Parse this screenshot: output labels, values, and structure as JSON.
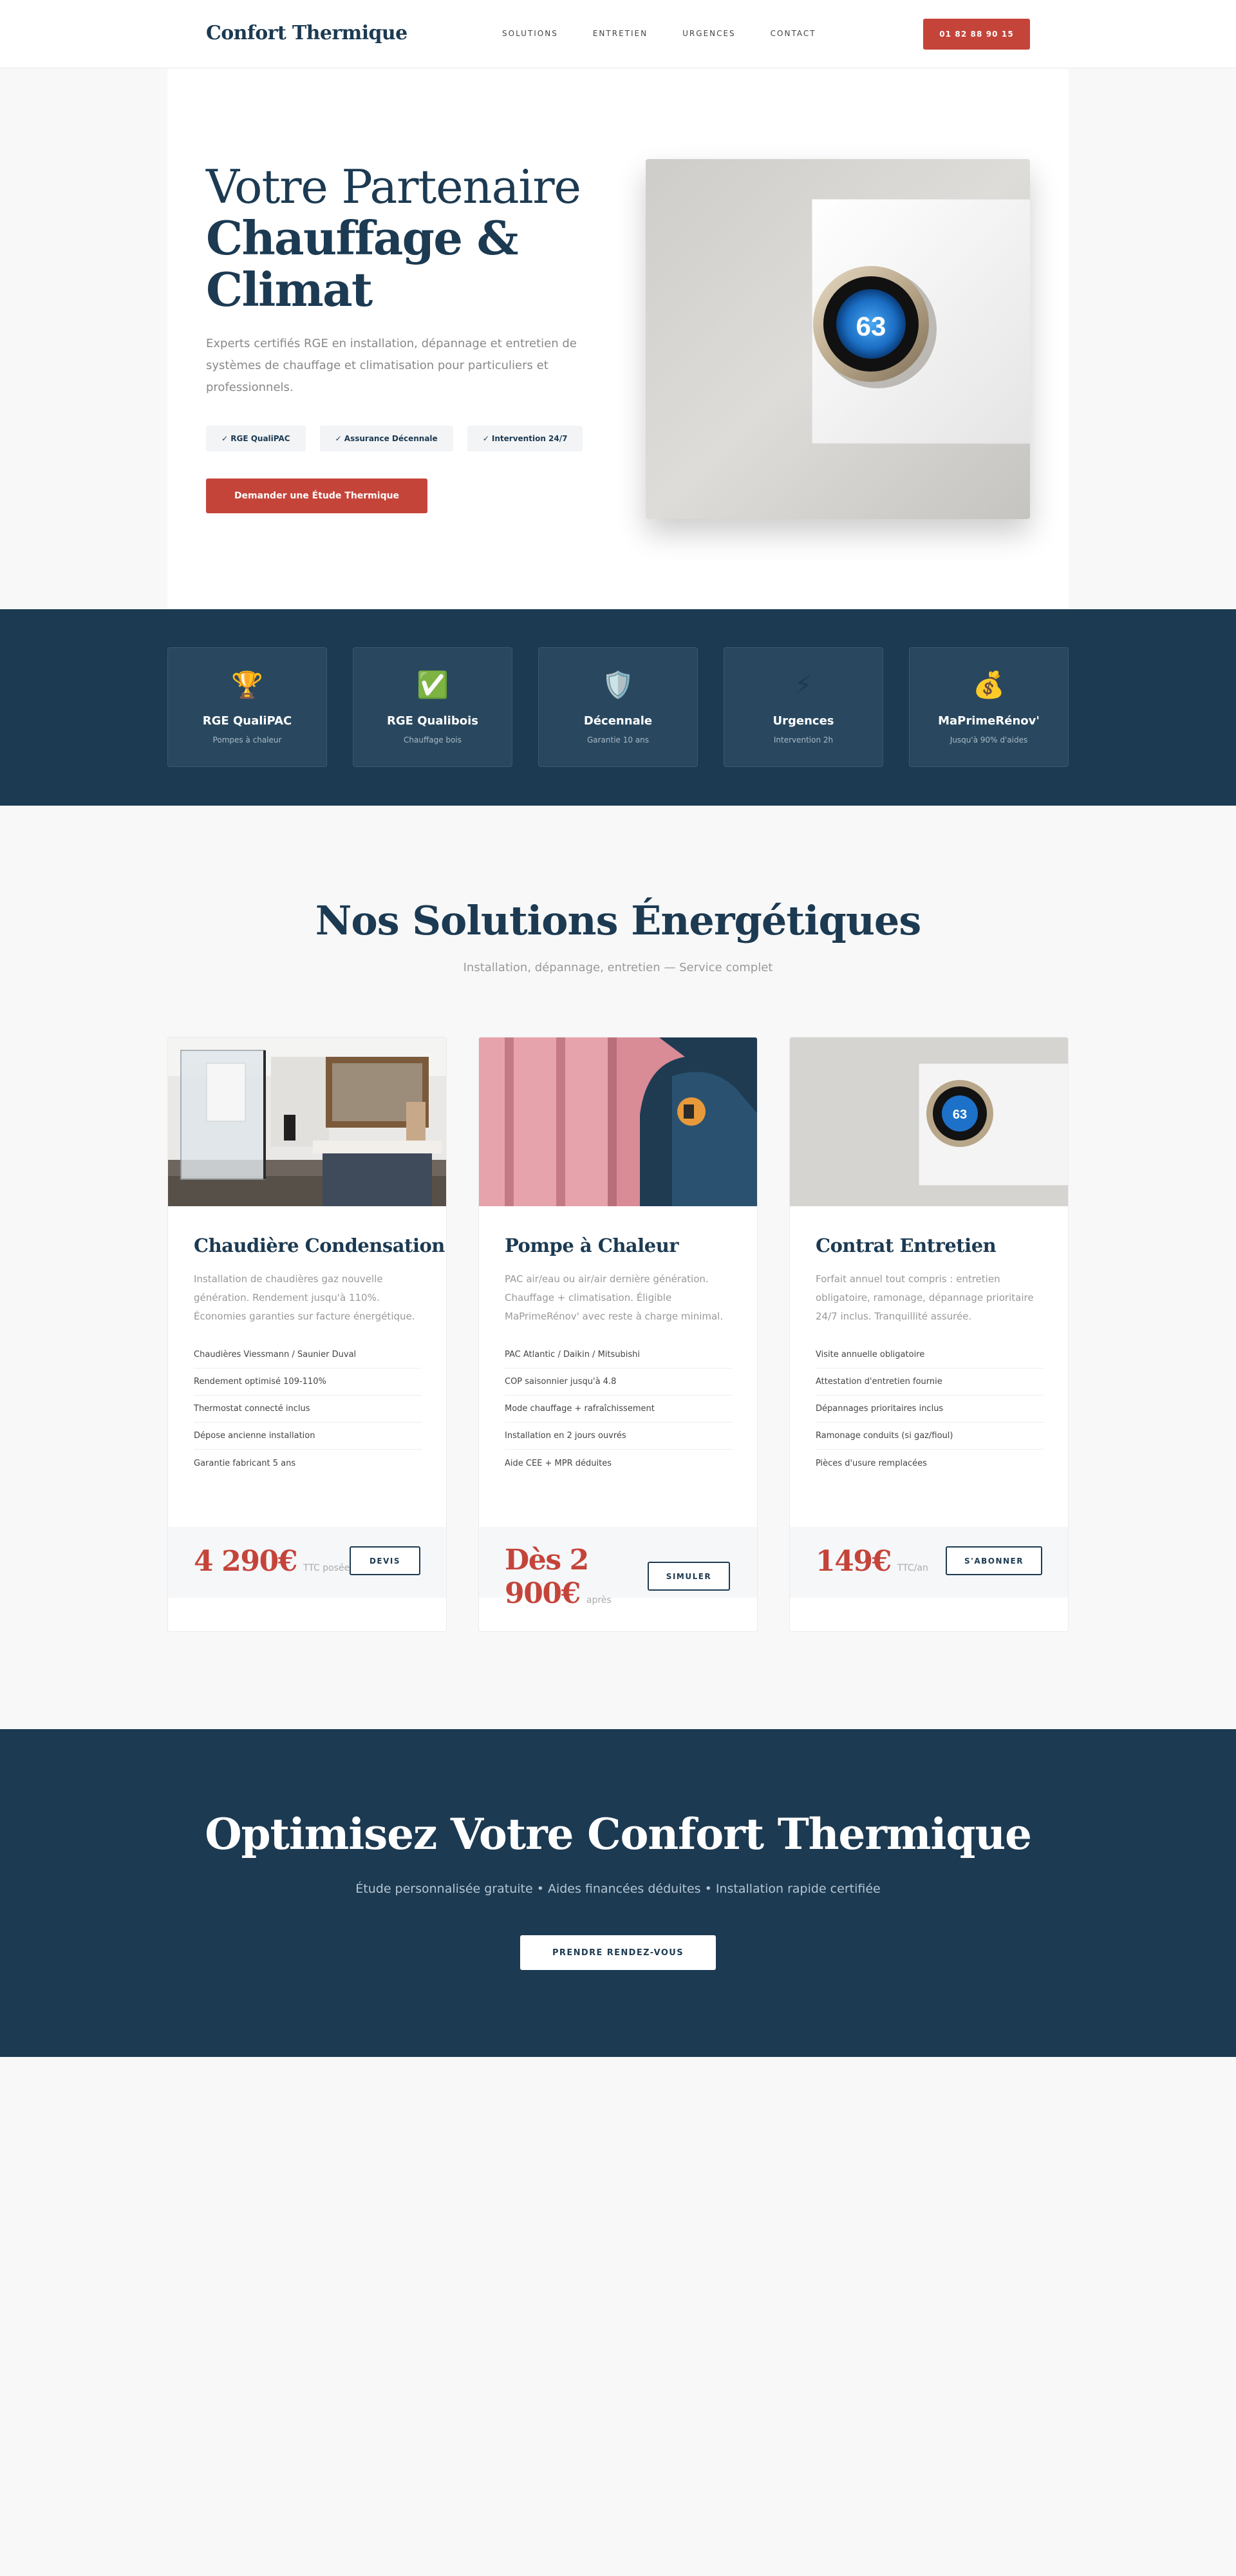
{
  "header": {
    "logo": "Confort Thermique",
    "nav": [
      "SOLUTIONS",
      "ENTRETIEN",
      "URGENCES",
      "CONTACT"
    ],
    "phone": "01 82 88 90 15"
  },
  "hero": {
    "title_line1": "Votre Partenaire",
    "title_line2": "Chauffage & Climat",
    "description": "Experts certifiés RGE en installation, dépannage et entretien de systèmes de chauffage et climatisation pour particuliers et professionnels.",
    "badges": [
      "✓ RGE QualiPAC",
      "✓ Assurance Décennale",
      "✓ Intervention 24/7"
    ],
    "cta": "Demander une Étude Thermique",
    "image_icon": "smart-thermostat",
    "thermostat_display": "63"
  },
  "certifications": [
    {
      "icon": "🏆",
      "title": "RGE QualiPAC",
      "subtitle": "Pompes à chaleur"
    },
    {
      "icon": "✅",
      "title": "RGE Qualibois",
      "subtitle": "Chauffage bois"
    },
    {
      "icon": "🛡️",
      "title": "Décennale",
      "subtitle": "Garantie 10 ans"
    },
    {
      "icon": "⚡",
      "title": "Urgences",
      "subtitle": "Intervention 2h"
    },
    {
      "icon": "💰",
      "title": "MaPrimeRénov'",
      "subtitle": "Jusqu'à 90% d'aides"
    }
  ],
  "solutions": {
    "title": "Nos Solutions Énergétiques",
    "subtitle": "Installation, dépannage, entretien — Service complet",
    "cards": [
      {
        "image_icon": "modern-bathroom",
        "title": "Chaudière Condensation",
        "description": "Installation de chaudières gaz nouvelle génération. Rendement jusqu'à 110%. Économies garanties sur facture énergétique.",
        "features": [
          "Chaudières Viessmann / Saunier Duval",
          "Rendement optimisé 109-110%",
          "Thermostat connecté inclus",
          "Dépose ancienne installation",
          "Garantie fabricant 5 ans"
        ],
        "price": "4 290€",
        "price_note": "TTC posée",
        "button": "DEVIS"
      },
      {
        "image_icon": "insulation-installer",
        "title": "Pompe à Chaleur",
        "description": "PAC air/eau ou air/air dernière génération. Chauffage + climatisation. Éligible MaPrimeRénov' avec reste à charge minimal.",
        "features": [
          "PAC Atlantic / Daikin / Mitsubishi",
          "COP saisonnier jusqu'à 4.8",
          "Mode chauffage + rafraîchissement",
          "Installation en 2 jours ouvrés",
          "Aide CEE + MPR déduites"
        ],
        "price": "Dès 2 900€",
        "price_note": "après aides",
        "button": "SIMULER"
      },
      {
        "image_icon": "smart-thermostat",
        "title": "Contrat Entretien",
        "description": "Forfait annuel tout compris : entretien obligatoire, ramonage, dépannage prioritaire 24/7 inclus. Tranquillité assurée.",
        "features": [
          "Visite annuelle obligatoire",
          "Attestation d'entretien fournie",
          "Dépannages prioritaires inclus",
          "Ramonage conduits (si gaz/fioul)",
          "Pièces d'usure remplacées"
        ],
        "price": "149€",
        "price_note": "TTC/an",
        "button": "S'ABONNER"
      }
    ]
  },
  "cta_band": {
    "title": "Optimisez Votre Confort Thermique",
    "subtitle": "Étude personnalisée gratuite • Aides financées déduites • Installation rapide certifiée",
    "button": "PRENDRE RENDEZ-VOUS"
  },
  "colors": {
    "navy": "#1c3a52",
    "accent_red": "#c5443a",
    "page_bg": "#f8f8f8"
  }
}
